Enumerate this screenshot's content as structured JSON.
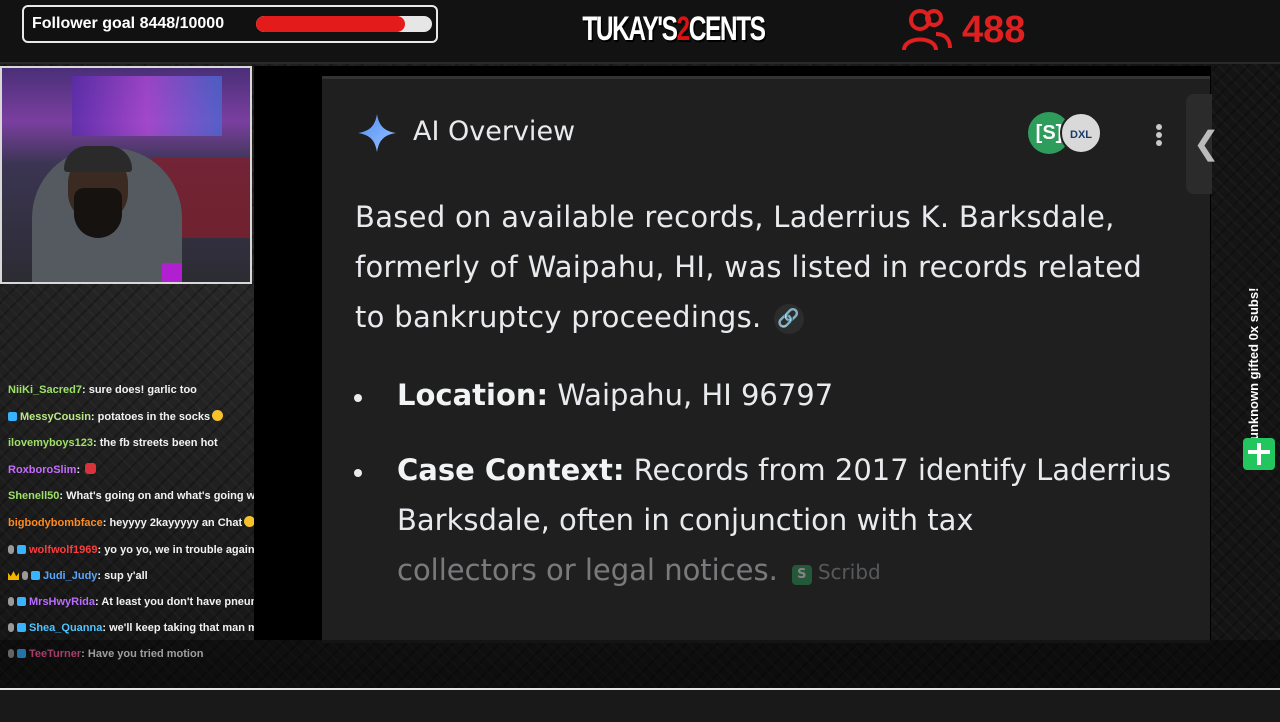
{
  "header": {
    "follower_goal_text": "Follower goal 8448/10000",
    "follower_goal_progress": 0.8448,
    "logo_text_a": "TUKAY'S",
    "logo_text_2": "2",
    "logo_text_b": "CENTS",
    "viewer_count": "488",
    "viewer_icon": "users-icon"
  },
  "chat": {
    "messages": [
      {
        "user": "NiiKi_Sacred7",
        "text": ": sure does! garlic too",
        "user_color": "#9fe06a"
      },
      {
        "user": "MessyCousin",
        "text": ": potatoes in the socks",
        "user_color": "#b8e986"
      },
      {
        "user": "ilovemyboys123",
        "text": ": the fb streets been hot",
        "user_color": "#9fe06a"
      },
      {
        "user": "RoxboroSlim",
        "text": ": ",
        "user_color": "#c56cff"
      },
      {
        "user": "Shenell50",
        "text": ": What's going on and what's going wrong",
        "user_color": "#9fe06a"
      },
      {
        "user": "bigbodybombface",
        "text": ": heyyyy 2kayyyyy an Chat",
        "user_color": "#ff8a1f"
      },
      {
        "user": "wolfwolf1969",
        "text": ": yo yo yo, we in trouble again",
        "user_color": "#ff3b3b"
      },
      {
        "user": "Judi_Judy",
        "text": ": sup y'all",
        "user_color": "#59a6ff"
      },
      {
        "user": "MrsHwyRida",
        "text": ": At least you don't have pneumonia like me lol",
        "user_color": "#b96cff"
      },
      {
        "user": "Shea_Quanna",
        "text": ": we'll keep taking that man made shi that don't work then",
        "user_color": "#4dc4ff"
      },
      {
        "user": "TeeTurner",
        "text": ": Have you tried motion",
        "user_color": "#ff5fa2"
      }
    ]
  },
  "ai_overview": {
    "title": "AI Overview",
    "source_icon_s": "[S]",
    "source_icon_d": "DXL",
    "paragraph": "Based on available records, Laderrius K. Barksdale, formerly of Waipahu, HI, was listed in records related to bankruptcy proceedings.",
    "link_icon": "🔗",
    "bullets": [
      {
        "label": "Location:",
        "text": " Waipahu, HI 96797"
      },
      {
        "label": "Case Context:",
        "text": " Records from 2017 identify Laderrius Barksdale, often in conjunction with tax",
        "faded_text": "collectors or legal notices.",
        "source_chip": "Scribd"
      }
    ],
    "collapse_glyph": "❮"
  },
  "sidebar_right": {
    "gifted_text": "unknown gifted 0x subs!"
  },
  "colors": {
    "accent_red": "#e41b1b",
    "gift_green": "#22c55e",
    "scribd_green": "#2e9c5a"
  }
}
